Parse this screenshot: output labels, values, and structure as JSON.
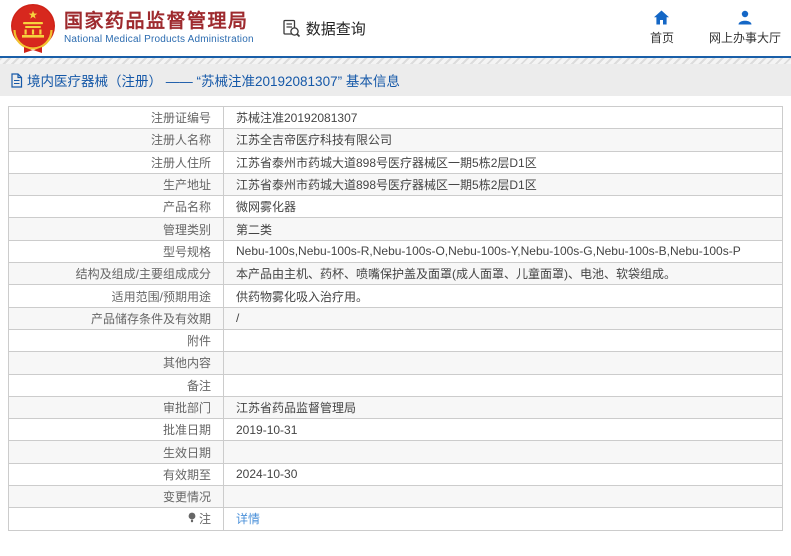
{
  "header": {
    "agency_name_cn": "国家药品监督管理局",
    "agency_name_en": "National Medical Products Administration",
    "data_query_label": "数据查询",
    "home_label": "首页",
    "service_hall_label": "网上办事大厅"
  },
  "breadcrumb": {
    "title": "境内医疗器械（注册） —— “苏械注准20192081307” 基本信息"
  },
  "detail_table": {
    "rows": [
      {
        "label": "注册证编号",
        "value": "苏械注准20192081307"
      },
      {
        "label": "注册人名称",
        "value": "江苏全吉帝医疗科技有限公司"
      },
      {
        "label": "注册人住所",
        "value": "江苏省泰州市药城大道898号医疗器械区一期5栋2层D1区"
      },
      {
        "label": "生产地址",
        "value": "江苏省泰州市药城大道898号医疗器械区一期5栋2层D1区"
      },
      {
        "label": "产品名称",
        "value": "微网雾化器"
      },
      {
        "label": "管理类别",
        "value": "第二类"
      },
      {
        "label": "型号规格",
        "value": "Nebu-100s,Nebu-100s-R,Nebu-100s-O,Nebu-100s-Y,Nebu-100s-G,Nebu-100s-B,Nebu-100s-P"
      },
      {
        "label": "结构及组成/主要组成成分",
        "value": "本产品由主机、药杯、喷嘴保护盖及面罩(成人面罩、儿童面罩)、电池、软袋组成。"
      },
      {
        "label": "适用范围/预期用途",
        "value": "供药物雾化吸入治疗用。"
      },
      {
        "label": "产品储存条件及有效期",
        "value": "/"
      },
      {
        "label": "附件",
        "value": ""
      },
      {
        "label": "其他内容",
        "value": ""
      },
      {
        "label": "备注",
        "value": ""
      },
      {
        "label": "审批部门",
        "value": "江苏省药品监督管理局"
      },
      {
        "label": "批准日期",
        "value": "2019-10-31"
      },
      {
        "label": "生效日期",
        "value": ""
      },
      {
        "label": "有效期至",
        "value": "2024-10-30"
      },
      {
        "label": "变更情况",
        "value": ""
      },
      {
        "label": "注",
        "value": "详情",
        "value_is_link": true,
        "label_icon": "note-icon"
      }
    ]
  },
  "colors": {
    "accent_blue": "#1a5fa8",
    "brand_red": "#9e2a2e",
    "brand_en_blue": "#2c6cb0",
    "icon_blue": "#1467c6",
    "link_blue": "#4a90d9",
    "title_band_bg": "#ececec",
    "row_alt_bg": "#f7f7f7",
    "table_border": "#cccccc"
  }
}
